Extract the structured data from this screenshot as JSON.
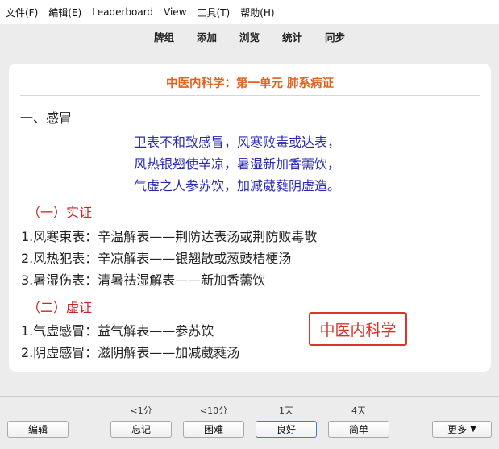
{
  "menu": {
    "items": [
      "文件(F)",
      "编辑(E)",
      "Leaderboard",
      "View",
      "工具(T)",
      "帮助(H)"
    ]
  },
  "toolbar": {
    "items": [
      "牌组",
      "添加",
      "浏览",
      "统计",
      "同步"
    ]
  },
  "card": {
    "title": "中医内科学：第一单元 肺系病证",
    "section_heading": "一、感冒",
    "poem": [
      "卫表不和致感冒，风寒败毒或达表，",
      "风热银翘使辛凉，暑湿新加香薷饮，",
      "气虚之人参苏饮，加减葳蕤阴虚造。"
    ],
    "sub1": "（一）实证",
    "list1": [
      "1.风寒束表：辛温解表——荆防达表汤或荆防败毒散",
      "2.风热犯表：辛凉解表——银翘散或葱豉桔梗汤",
      "3.暑湿伤表：清暑祛湿解表——新加香薷饮"
    ],
    "sub2": "（二）虚证",
    "list2": [
      "1.气虚感冒：益气解表——参苏饮",
      "2.阴虚感冒：滋阴解表——加减葳蕤汤"
    ],
    "stamp": "中医内科学"
  },
  "bottom": {
    "edit_label": "编辑",
    "answers": [
      {
        "hint": "<1分",
        "label": "忘记"
      },
      {
        "hint": "<10分",
        "label": "困难"
      },
      {
        "hint": "1天",
        "label": "良好"
      },
      {
        "hint": "4天",
        "label": "简单"
      }
    ],
    "more_label": "更多",
    "more_icon": "triangle-down-icon"
  }
}
